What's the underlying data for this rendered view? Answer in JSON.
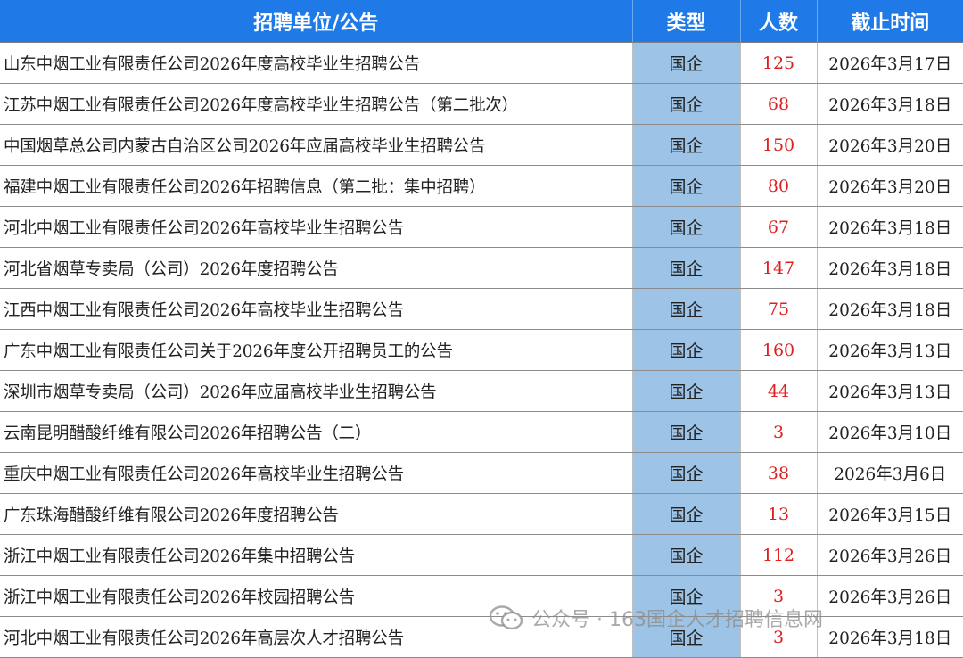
{
  "header": {
    "name": "招聘单位/公告",
    "type": "类型",
    "count": "人数",
    "deadline": "截止时间"
  },
  "rows": [
    {
      "name": "山东中烟工业有限责任公司2026年度高校毕业生招聘公告",
      "type": "国企",
      "count": "125",
      "deadline": "2026年3月17日"
    },
    {
      "name": "江苏中烟工业有限责任公司2026年度高校毕业生招聘公告（第二批次）",
      "type": "国企",
      "count": "68",
      "deadline": "2026年3月18日"
    },
    {
      "name": "中国烟草总公司内蒙古自治区公司2026年应届高校毕业生招聘公告",
      "type": "国企",
      "count": "150",
      "deadline": "2026年3月20日"
    },
    {
      "name": "福建中烟工业有限责任公司2026年招聘信息（第二批：集中招聘）",
      "type": "国企",
      "count": "80",
      "deadline": "2026年3月20日"
    },
    {
      "name": "河北中烟工业有限责任公司2026年高校毕业生招聘公告",
      "type": "国企",
      "count": "67",
      "deadline": "2026年3月18日"
    },
    {
      "name": "河北省烟草专卖局（公司）2026年度招聘公告",
      "type": "国企",
      "count": "147",
      "deadline": "2026年3月18日"
    },
    {
      "name": "江西中烟工业有限责任公司2026年高校毕业生招聘公告",
      "type": "国企",
      "count": "75",
      "deadline": "2026年3月18日"
    },
    {
      "name": "广东中烟工业有限责任公司关于2026年度公开招聘员工的公告",
      "type": "国企",
      "count": "160",
      "deadline": "2026年3月13日"
    },
    {
      "name": "深圳市烟草专卖局（公司）2026年应届高校毕业生招聘公告",
      "type": "国企",
      "count": "44",
      "deadline": "2026年3月13日"
    },
    {
      "name": "云南昆明醋酸纤维有限公司2026年招聘公告（二）",
      "type": "国企",
      "count": "3",
      "deadline": "2026年3月10日"
    },
    {
      "name": "重庆中烟工业有限责任公司2026年高校毕业生招聘公告",
      "type": "国企",
      "count": "38",
      "deadline": "2026年3月6日"
    },
    {
      "name": "广东珠海醋酸纤维有限公司2026年度招聘公告",
      "type": "国企",
      "count": "13",
      "deadline": "2026年3月15日"
    },
    {
      "name": "浙江中烟工业有限责任公司2026年集中招聘公告",
      "type": "国企",
      "count": "112",
      "deadline": "2026年3月26日"
    },
    {
      "name": "浙江中烟工业有限责任公司2026年校园招聘公告",
      "type": "国企",
      "count": "3",
      "deadline": "2026年3月26日"
    },
    {
      "name": "河北中烟工业有限责任公司2026年高层次人才招聘公告",
      "type": "国企",
      "count": "3",
      "deadline": "2026年3月18日"
    }
  ],
  "watermark": {
    "text": "公众号 · 163国企人才招聘信息网",
    "icon": "wechat-icon"
  },
  "colors": {
    "header_bg": "#1f7ae8",
    "type_column_bg": "#9dc3e6",
    "count_text": "#e02020"
  }
}
